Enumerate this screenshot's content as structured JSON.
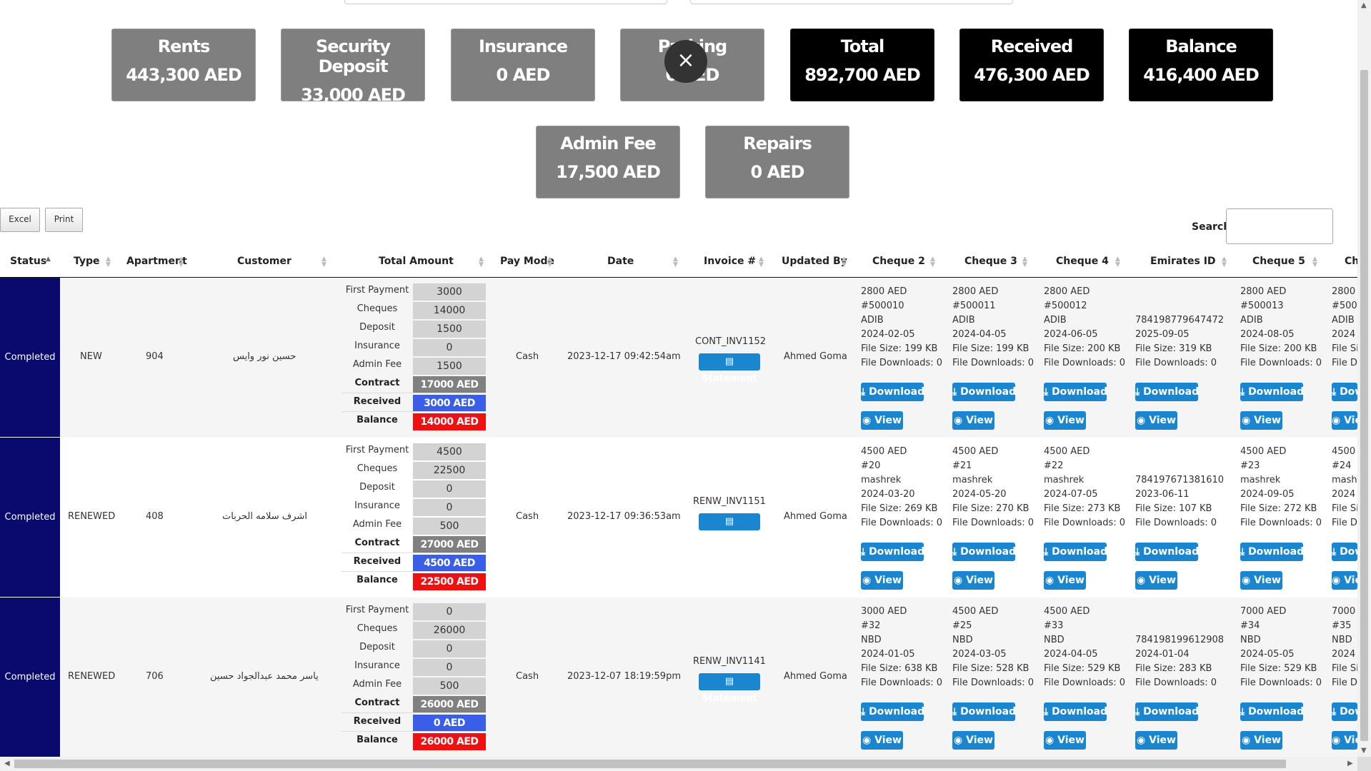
{
  "cards": {
    "rents": {
      "title": "Rents",
      "value": "443,300 AED"
    },
    "security_deposit": {
      "title": "Security Deposit",
      "value": "33,000 AED"
    },
    "insurance": {
      "title": "Insurance",
      "value": "0 AED"
    },
    "parking": {
      "title": "Parking",
      "value": "0 AED"
    },
    "total": {
      "title": "Total",
      "value": "892,700 AED"
    },
    "received": {
      "title": "Received",
      "value": "476,300 AED"
    },
    "balance": {
      "title": "Balance",
      "value": "416,400 AED"
    },
    "admin_fee": {
      "title": "Admin Fee",
      "value": "17,500 AED"
    },
    "repairs": {
      "title": "Repairs",
      "value": "0 AED"
    }
  },
  "overlay": {
    "close_glyph": "×"
  },
  "toolbar": {
    "excel_label": "Excel",
    "print_label": "Print",
    "search_label": "Search:"
  },
  "columns": [
    "Status",
    "Type",
    "Apartment",
    "Customer",
    "Total Amount",
    "Pay Mode",
    "Date",
    "Invoice #",
    "Updated By",
    "Cheque 2",
    "Cheque 3",
    "Cheque 4",
    "Emirates ID",
    "Cheque 5",
    "Che"
  ],
  "amount_labels": {
    "first_payment": "First Payment",
    "cheques": "Cheques",
    "deposit": "Deposit",
    "insurance": "Insurance",
    "admin_fee": "Admin Fee",
    "contract": "Contract",
    "received": "Received",
    "balance": "Balance"
  },
  "button_labels": {
    "statement": "Statement",
    "download": "Download",
    "view": "View"
  },
  "colors": {
    "status_bg": "#0a0a6e",
    "button_blue": "#1a86d0",
    "received_blue": "#3b5ee8",
    "balance_red": "#ee1111"
  },
  "rows": [
    {
      "status": "Completed",
      "type": "NEW",
      "apartment": "904",
      "customer": "حسين نور وايس",
      "first_payment": "3000",
      "cheques": "14000",
      "deposit": "1500",
      "insurance": "0",
      "admin_fee": "1500",
      "contract": "17000 AED",
      "received": "3000 AED",
      "balance": "14000 AED",
      "pay_mode": "Cash",
      "date": "2023-12-17 09:42:54am",
      "invoice": "CONT_INV1152",
      "updated_by": "Ahmed Goma",
      "cheque2": {
        "amount": "2800 AED",
        "no": "#500010",
        "bank": "ADIB",
        "date": "2024-02-05",
        "size": "File Size: 199 KB",
        "downloads": "File Downloads: 0"
      },
      "cheque3": {
        "amount": "2800 AED",
        "no": "#500011",
        "bank": "ADIB",
        "date": "2024-04-05",
        "size": "File Size: 199 KB",
        "downloads": "File Downloads: 0"
      },
      "cheque4": {
        "amount": "2800 AED",
        "no": "#500012",
        "bank": "ADIB",
        "date": "2024-06-05",
        "size": "File Size: 200 KB",
        "downloads": "File Downloads: 0"
      },
      "emirates": {
        "id": "784198779647472",
        "date": "2025-09-05",
        "size": "File Size: 319 KB",
        "downloads": "File Downloads: 0"
      },
      "cheque5": {
        "amount": "2800 AED",
        "no": "#500013",
        "bank": "ADIB",
        "date": "2024-08-05",
        "size": "File Size: 200 KB",
        "downloads": "File Downloads: 0"
      },
      "cheque6": {
        "amount": "2800",
        "no": "#500",
        "bank": "ADIB",
        "date": "2024",
        "size": "File Si",
        "downloads": "File D"
      }
    },
    {
      "status": "Completed",
      "type": "RENEWED",
      "apartment": "408",
      "customer": "اشرف سلامه الحربات",
      "first_payment": "4500",
      "cheques": "22500",
      "deposit": "0",
      "insurance": "0",
      "admin_fee": "500",
      "contract": "27000 AED",
      "received": "4500 AED",
      "balance": "22500 AED",
      "pay_mode": "Cash",
      "date": "2023-12-17 09:36:53am",
      "invoice": "RENW_INV1151",
      "updated_by": "Ahmed Goma",
      "cheque2": {
        "amount": "4500 AED",
        "no": "#20",
        "bank": "mashrek",
        "date": "2024-03-20",
        "size": "File Size: 269 KB",
        "downloads": "File Downloads: 0"
      },
      "cheque3": {
        "amount": "4500 AED",
        "no": "#21",
        "bank": "mashrek",
        "date": "2024-05-20",
        "size": "File Size: 270 KB",
        "downloads": "File Downloads: 0"
      },
      "cheque4": {
        "amount": "4500 AED",
        "no": "#22",
        "bank": "mashrek",
        "date": "2024-07-05",
        "size": "File Size: 273 KB",
        "downloads": "File Downloads: 0"
      },
      "emirates": {
        "id": "784197671381610",
        "date": "2023-06-11",
        "size": "File Size: 107 KB",
        "downloads": "File Downloads: 0"
      },
      "cheque5": {
        "amount": "4500 AED",
        "no": "#23",
        "bank": "mashrek",
        "date": "2024-09-05",
        "size": "File Size: 272 KB",
        "downloads": "File Downloads: 0"
      },
      "cheque6": {
        "amount": "4500",
        "no": "#24",
        "bank": "mashi",
        "date": "2024",
        "size": "File Si",
        "downloads": "File D"
      }
    },
    {
      "status": "Completed",
      "type": "RENEWED",
      "apartment": "706",
      "customer": "ياسر محمد عبدالجواد حسين",
      "first_payment": "0",
      "cheques": "26000",
      "deposit": "0",
      "insurance": "0",
      "admin_fee": "500",
      "contract": "26000 AED",
      "received": "0 AED",
      "balance": "26000 AED",
      "pay_mode": "Cash",
      "date": "2023-12-07 18:19:59pm",
      "invoice": "RENW_INV1141",
      "updated_by": "Ahmed Goma",
      "cheque2": {
        "amount": "3000 AED",
        "no": "#32",
        "bank": "NBD",
        "date": "2024-01-05",
        "size": "File Size: 638 KB",
        "downloads": "File Downloads: 0"
      },
      "cheque3": {
        "amount": "4500 AED",
        "no": "#25",
        "bank": "NBD",
        "date": "2024-03-05",
        "size": "File Size: 528 KB",
        "downloads": "File Downloads: 0"
      },
      "cheque4": {
        "amount": "4500 AED",
        "no": "#33",
        "bank": "NBD",
        "date": "2024-04-05",
        "size": "File Size: 529 KB",
        "downloads": "File Downloads: 0"
      },
      "emirates": {
        "id": "784198199612908",
        "date": "2024-01-04",
        "size": "File Size: 283 KB",
        "downloads": "File Downloads: 0"
      },
      "cheque5": {
        "amount": "7000 AED",
        "no": "#34",
        "bank": "NBD",
        "date": "2024-05-05",
        "size": "File Size: 529 KB",
        "downloads": "File Downloads: 0"
      },
      "cheque6": {
        "amount": "7000",
        "no": "#35",
        "bank": "NBD",
        "date": "2024",
        "size": "File Si",
        "downloads": "File D"
      }
    }
  ]
}
